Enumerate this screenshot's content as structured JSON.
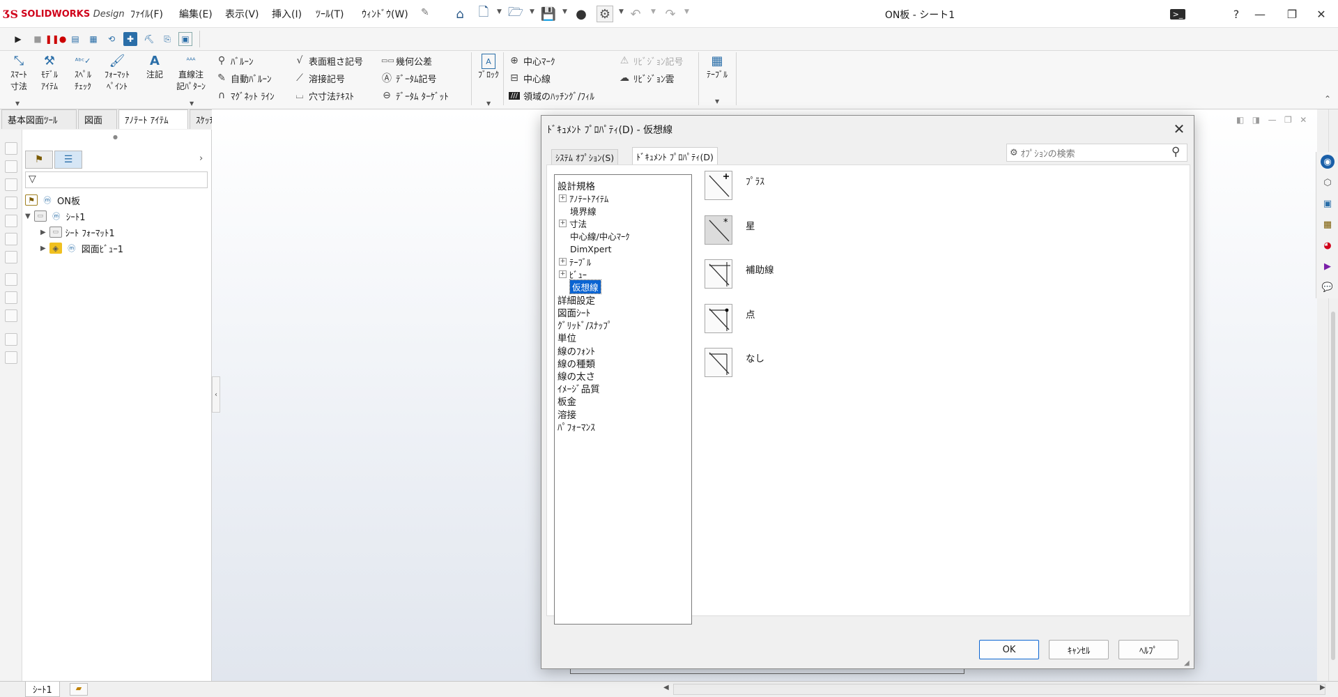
{
  "app": {
    "logo_brand": "SOLIDWORKS",
    "logo_suffix": "Design",
    "doc_title": "ON板 - シート1"
  },
  "menu": [
    "ﾌｧｲﾙ(F)",
    "編集(E)",
    "表示(V)",
    "挿入(I)",
    "ﾂｰﾙ(T)",
    "ｳｨﾝﾄﾞｳ(W)"
  ],
  "ribbon": {
    "smart_dim": [
      "ｽﾏｰﾄ",
      "寸法"
    ],
    "model_items": [
      "ﾓﾃﾞﾙ",
      "ｱｲﾃﾑ"
    ],
    "spell": [
      "ｽﾍﾟﾙ",
      "ﾁｪｯｸ"
    ],
    "format_paint": [
      "ﾌｫｰﾏｯﾄ",
      "ﾍﾟｲﾝﾄ"
    ],
    "note": "注記",
    "linear_pattern": [
      "直線注",
      "記ﾊﾟﾀｰﾝ"
    ],
    "balloon": "ﾊﾞﾙｰﾝ",
    "auto_balloon": "自動ﾊﾞﾙｰﾝ",
    "magnet_line": "ﾏｸﾞﾈｯﾄ ﾗｲﾝ",
    "surface_finish": "表面粗さ記号",
    "weld_symbol": "溶接記号",
    "hole_callout": "穴寸法ﾃｷｽﾄ",
    "gtol": "幾何公差",
    "datum_feature": "ﾃﾞｰﾀﾑ記号",
    "datum_target": "ﾃﾞｰﾀﾑ ﾀｰｹﾞｯﾄ",
    "block": "ﾌﾞﾛｯｸ",
    "center_mark": "中心ﾏｰｸ",
    "centerline": "中心線",
    "hatch": "領域のﾊｯﾁﾝｸﾞ/ﾌｨﾙ",
    "revision_symbol": "ﾘﾋﾞｼﾞｮﾝ記号",
    "revision_cloud": "ﾘﾋﾞｼﾞｮﾝ雲",
    "table": "ﾃｰﾌﾞﾙ"
  },
  "cm_tabs": [
    "基本図面ﾂｰﾙ",
    "図面",
    "ｱﾉﾃｰﾄ ｱｲﾃﾑ",
    "ｽｹｯﾁ"
  ],
  "feature_tree": {
    "root": "ON板",
    "sheet": "ｼｰﾄ1",
    "sheet_format": "ｼｰﾄ ﾌｫｰﾏｯﾄ1",
    "drawing_view": "図面ﾋﾞｭｰ1"
  },
  "dialog": {
    "title": "ﾄﾞｷｭﾒﾝﾄ ﾌﾟﾛﾊﾟﾃｨ(D) - 仮想線",
    "tab_system": "ｼｽﾃﾑ ｵﾌﾟｼｮﾝ(S)",
    "tab_document": "ﾄﾞｷｭﾒﾝﾄ ﾌﾟﾛﾊﾟﾃｨ(D)",
    "search_placeholder": "ｵﾌﾟｼｮﾝの検索",
    "tree": [
      {
        "label": "設計規格",
        "level": 0,
        "expander": ""
      },
      {
        "label": "ｱﾉﾃｰﾄｱｲﾃﾑ",
        "level": 1,
        "expander": "+"
      },
      {
        "label": "境界線",
        "level": 1,
        "expander": ""
      },
      {
        "label": "寸法",
        "level": 1,
        "expander": "+"
      },
      {
        "label": "中心線/中心ﾏｰｸ",
        "level": 1,
        "expander": ""
      },
      {
        "label": "DimXpert",
        "level": 1,
        "expander": ""
      },
      {
        "label": "ﾃｰﾌﾞﾙ",
        "level": 1,
        "expander": "+"
      },
      {
        "label": "ﾋﾞｭｰ",
        "level": 1,
        "expander": "+"
      },
      {
        "label": "仮想線",
        "level": 1,
        "expander": "",
        "selected": true
      },
      {
        "label": "詳細設定",
        "level": 0,
        "expander": ""
      },
      {
        "label": "図面ｼｰﾄ",
        "level": 0,
        "expander": ""
      },
      {
        "label": "ｸﾞﾘｯﾄﾞ/ｽﾅｯﾌﾟ",
        "level": 0,
        "expander": ""
      },
      {
        "label": "単位",
        "level": 0,
        "expander": ""
      },
      {
        "label": "線のﾌｫﾝﾄ",
        "level": 0,
        "expander": ""
      },
      {
        "label": "線の種類",
        "level": 0,
        "expander": ""
      },
      {
        "label": "線の太さ",
        "level": 0,
        "expander": ""
      },
      {
        "label": "ｲﾒｰｼﾞ品質",
        "level": 0,
        "expander": ""
      },
      {
        "label": "板金",
        "level": 0,
        "expander": ""
      },
      {
        "label": "溶接",
        "level": 0,
        "expander": ""
      },
      {
        "label": "ﾊﾟﾌｫｰﾏﾝｽ",
        "level": 0,
        "expander": ""
      }
    ],
    "options": [
      {
        "label": "ﾌﾟﾗｽ",
        "marker": "plus",
        "selected": false
      },
      {
        "label": "星",
        "marker": "star",
        "selected": true
      },
      {
        "label": "補助線",
        "marker": "extension-line",
        "selected": false
      },
      {
        "label": "点",
        "marker": "dot",
        "selected": false
      },
      {
        "label": "なし",
        "marker": "none",
        "selected": false
      }
    ],
    "btn_ok": "OK",
    "btn_cancel": "ｷｬﾝｾﾙ",
    "btn_help": "ﾍﾙﾌﾟ"
  },
  "bottom": {
    "sheet_tab": "ｼｰﾄ1"
  },
  "colors": {
    "accent": "#0a64d2",
    "brand_red": "#d0021b"
  }
}
